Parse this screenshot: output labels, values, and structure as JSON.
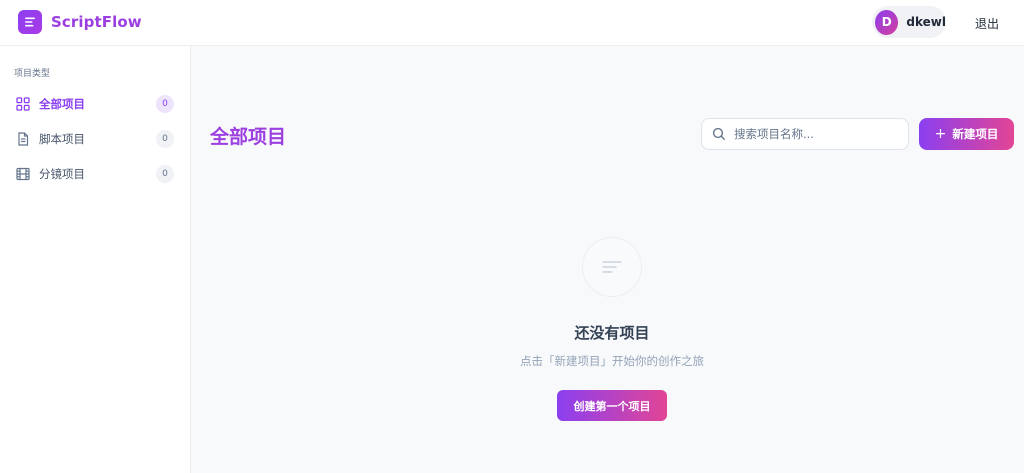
{
  "brand": {
    "name": "ScriptFlow",
    "accent": "#8b3ff0",
    "accent_end": "#e24595"
  },
  "header": {
    "user": {
      "initial": "D",
      "name": "dkewl"
    },
    "logout_label": "退出"
  },
  "sidebar": {
    "heading": "项目类型",
    "items": [
      {
        "label": "全部项目",
        "count": "0",
        "icon": "grid-icon",
        "active": true
      },
      {
        "label": "脚本项目",
        "count": "0",
        "icon": "document-icon",
        "active": false
      },
      {
        "label": "分镜项目",
        "count": "0",
        "icon": "film-icon",
        "active": false
      }
    ]
  },
  "main": {
    "title": "全部项目",
    "search": {
      "placeholder": "搜索项目名称...",
      "value": ""
    },
    "new_button_label": "新建项目",
    "empty_state": {
      "title": "还没有项目",
      "subtitle": "点击「新建项目」开始你的创作之旅",
      "button_label": "创建第一个项目"
    }
  }
}
